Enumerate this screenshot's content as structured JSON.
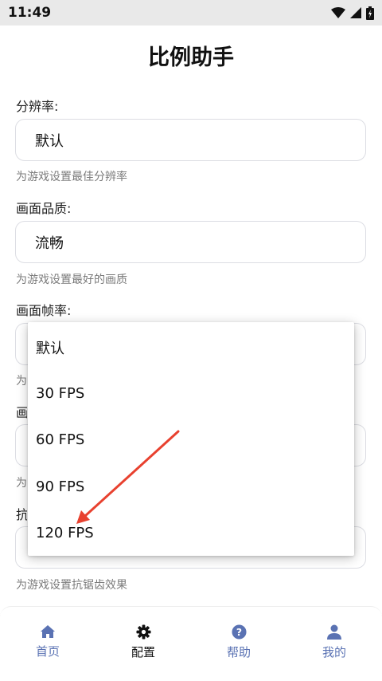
{
  "status": {
    "time": "11:49"
  },
  "page": {
    "title": "比例助手"
  },
  "sections": [
    {
      "label": "分辨率:",
      "value": "默认",
      "hint": "为游戏设置最佳分辨率"
    },
    {
      "label": "画面品质:",
      "value": "流畅",
      "hint": "为游戏设置最好的画质"
    },
    {
      "label": "画面帧率:",
      "value": "",
      "hint": "为"
    },
    {
      "label": "画",
      "value": "",
      "hint": "为"
    },
    {
      "label": "抗",
      "value": "",
      "hint": "为游戏设置抗锯齿效果"
    }
  ],
  "dropdown": {
    "options": [
      "默认",
      "30 FPS",
      "60 FPS",
      "90 FPS",
      "120 FPS"
    ]
  },
  "annotation": {
    "arrow_color": "#e8412f"
  },
  "tabs": [
    {
      "label": "首页",
      "icon": "home-icon"
    },
    {
      "label": "配置",
      "icon": "gear-icon"
    },
    {
      "label": "帮助",
      "icon": "help-icon"
    },
    {
      "label": "我的",
      "icon": "user-icon"
    }
  ],
  "colors": {
    "tab_inactive": "#5a72b3",
    "tab_active": "#111111"
  }
}
